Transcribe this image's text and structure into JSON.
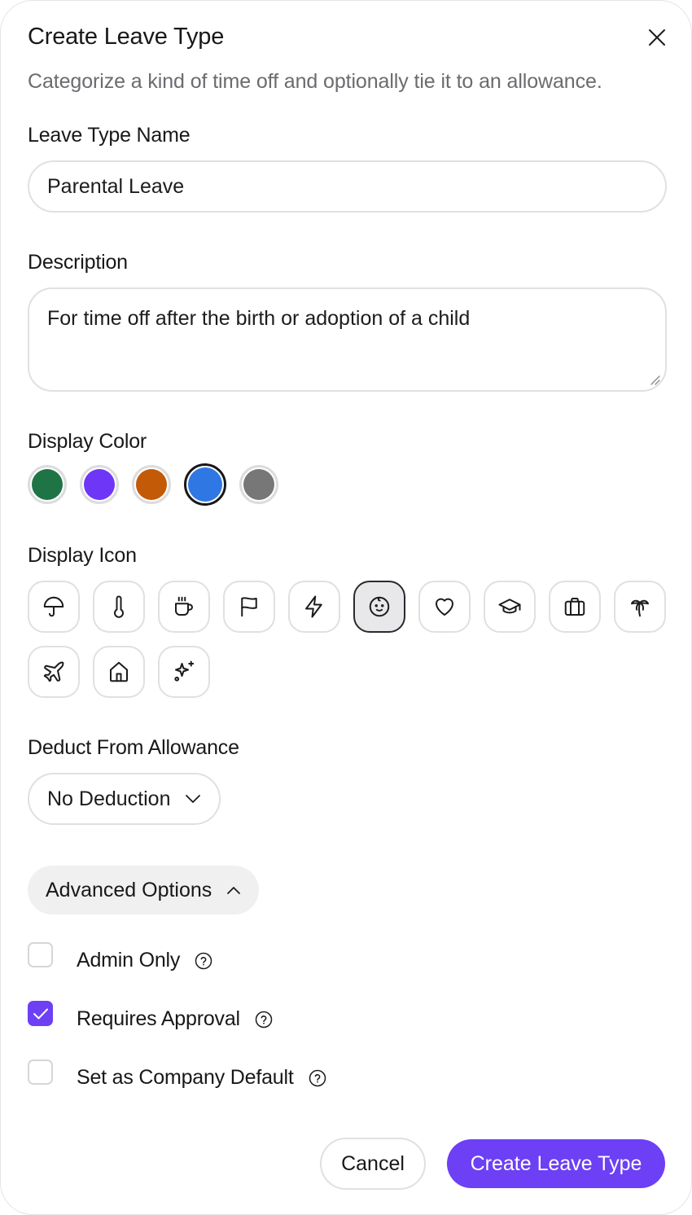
{
  "dialog": {
    "title": "Create Leave Type",
    "subtitle": "Categorize a kind of time off and optionally tie it to an allowance."
  },
  "name_field": {
    "label": "Leave Type Name",
    "value": "Parental Leave"
  },
  "description_field": {
    "label": "Description",
    "value": "For time off after the birth or adoption of a child"
  },
  "display_color": {
    "label": "Display Color",
    "selected": "blue",
    "options": [
      {
        "name": "green",
        "hex": "#1f7446"
      },
      {
        "name": "purple",
        "hex": "#6e36f6"
      },
      {
        "name": "orange",
        "hex": "#c25a07"
      },
      {
        "name": "blue",
        "hex": "#2f78e3"
      },
      {
        "name": "gray",
        "hex": "#777777"
      }
    ]
  },
  "display_icon": {
    "label": "Display Icon",
    "selected": "baby-icon",
    "options": [
      "umbrella-icon",
      "thermometer-icon",
      "coffee-icon",
      "flag-icon",
      "zap-icon",
      "baby-icon",
      "heart-icon",
      "graduation-cap-icon",
      "briefcase-icon",
      "palm-tree-icon",
      "plane-icon",
      "home-icon",
      "sparkles-icon"
    ]
  },
  "deduct": {
    "label": "Deduct From Allowance",
    "value": "No Deduction"
  },
  "advanced": {
    "label": "Advanced Options",
    "expanded": true,
    "options": [
      {
        "label": "Admin Only",
        "checked": false
      },
      {
        "label": "Requires Approval",
        "checked": true
      },
      {
        "label": "Set as Company Default",
        "checked": false
      }
    ]
  },
  "actions": {
    "cancel_label": "Cancel",
    "create_label": "Create Leave Type"
  },
  "colors": {
    "accent": "#6d3ff5",
    "border": "#e0e0e3",
    "muted_text": "#6b6b70"
  }
}
